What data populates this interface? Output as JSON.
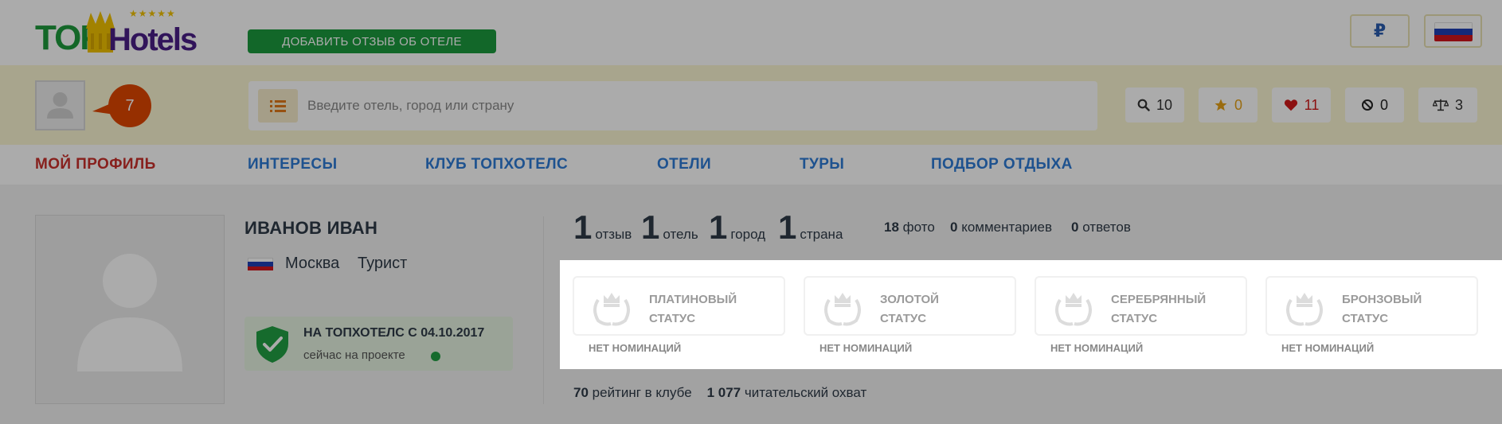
{
  "header": {
    "logo_top": "TOP",
    "logo_hotels": "Hotels",
    "logo_stars": "★★★★★",
    "add_review_label": "ДОБАВИТЬ ОТЗЫВ ОБ ОТЕЛЕ",
    "currency_symbol": "₽",
    "language_flag": "russia-flag-icon"
  },
  "user_bar": {
    "notifications_count": "7",
    "search_placeholder": "Введите отель, город или страну",
    "counters": [
      {
        "icon": "search-icon",
        "value": "10",
        "color": "#333333"
      },
      {
        "icon": "star-icon",
        "value": "0",
        "color": "#e6a117"
      },
      {
        "icon": "heart-icon",
        "value": "11",
        "color": "#d11a1a"
      },
      {
        "icon": "block-icon",
        "value": "0",
        "color": "#222222"
      },
      {
        "icon": "scales-icon",
        "value": "3",
        "color": "#333333"
      }
    ]
  },
  "nav": {
    "items": [
      "МОЙ ПРОФИЛЬ",
      "ИНТЕРЕСЫ",
      "КЛУБ ТОПХОТЕЛС",
      "ОТЕЛИ",
      "ТУРЫ",
      "ПОДБОР ОТДЫХА"
    ],
    "active_index": 0
  },
  "profile": {
    "name": "ИВАНОВ ИВАН",
    "city": "Москва",
    "role": "Турист",
    "since_title": "НА ТОПХОТЕЛС С 04.10.2017",
    "since_sub": "сейчас на проекте"
  },
  "stats": {
    "big": [
      {
        "num": "1",
        "label": "отзыв"
      },
      {
        "num": "1",
        "label": "отель"
      },
      {
        "num": "1",
        "label": "город"
      },
      {
        "num": "1",
        "label": "страна"
      }
    ],
    "small": [
      {
        "num": "18",
        "label": "фото"
      },
      {
        "num": "0",
        "label": "комментариев"
      },
      {
        "num": "0",
        "label": "ответов"
      }
    ]
  },
  "statuses": [
    {
      "line1": "ПЛАТИНОВЫЙ",
      "line2": "СТАТУС",
      "nominations": "НЕТ НОМИНАЦИЙ"
    },
    {
      "line1": "ЗОЛОТОЙ",
      "line2": "СТАТУС",
      "nominations": "НЕТ НОМИНАЦИЙ"
    },
    {
      "line1": "СЕРЕБРЯННЫЙ",
      "line2": "СТАТУС",
      "nominations": "НЕТ НОМИНАЦИЙ"
    },
    {
      "line1": "БРОНЗОВЫЙ",
      "line2": "СТАТУС",
      "nominations": "НЕТ НОМИНАЦИЙ"
    }
  ],
  "club": {
    "rating_num": "70",
    "rating_label": "рейтинг в клубе",
    "reach_num": "1 077",
    "reach_label": "читательский охват"
  },
  "colors": {
    "brand_green": "#1c9a3e",
    "nav_blue": "#2e7bd6",
    "nav_active_red": "#c9302c",
    "notification_orange": "#e04600",
    "band_yellow": "#fbf6d2"
  }
}
